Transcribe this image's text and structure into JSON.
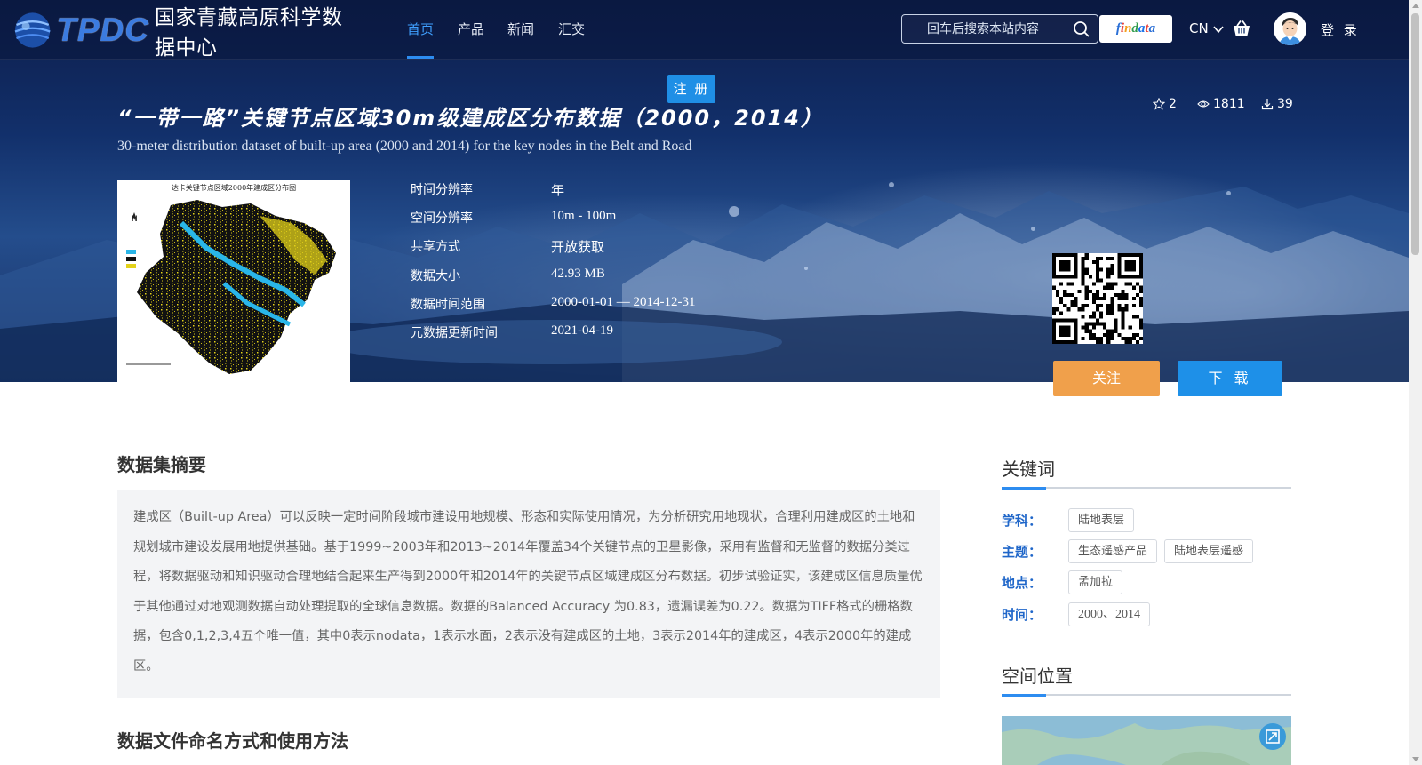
{
  "header": {
    "logo_text": "TPDC",
    "logo_cn": "国家青藏高原科学数据中心",
    "nav": [
      "首页",
      "产品",
      "新闻",
      "汇交"
    ],
    "search_placeholder": "回车后搜索本站内容",
    "findata_label": "findata",
    "findata_letters": [
      "f",
      "i",
      "n",
      "d",
      "a",
      "t",
      "a"
    ],
    "findata_colors": [
      "#2a6fd6",
      "#e8453c",
      "#f2a01e",
      "#2f9b4c",
      "#1a73e8",
      "#e8453c",
      "#2a6fd6"
    ],
    "language": "CN",
    "login": "登 录"
  },
  "register_label": "注 册",
  "dataset": {
    "title": "“一带一路”关键节点区域30m级建成区分布数据（2000，2014）",
    "subtitle": "30-meter distribution dataset of built-up area (2000 and 2014) for the key nodes in the Belt and Road",
    "stars": "2",
    "views": "1811",
    "downloads": "39",
    "thumbnail_caption": "达卡关键节点区域2000年建成区分布图",
    "meta": [
      {
        "key": "时间分辨率",
        "value": "年"
      },
      {
        "key": "空间分辨率",
        "value": "10m - 100m"
      },
      {
        "key": "共享方式",
        "value": "开放获取"
      },
      {
        "key": "数据大小",
        "value": "42.93 MB"
      },
      {
        "key": "数据时间范围",
        "value": "2000-01-01 — 2014-12-31"
      },
      {
        "key": "元数据更新时间",
        "value": "2021-04-19"
      }
    ],
    "follow_label": "关注",
    "download_label": "下 载"
  },
  "abstract": {
    "heading": "数据集摘要",
    "text": "建成区（Built-up Area）可以反映一定时间阶段城市建设用地规模、形态和实际使用情况，为分析研究用地现状，合理利用建成区的土地和规划城市建设发展用地提供基础。基于1999~2003年和2013~2014年覆盖34个关键节点的卫星影像，采用有监督和无监督的数据分类过程，将数据驱动和知识驱动合理地结合起来生产得到2000年和2014年的关键节点区域建成区分布数据。初步试验证实，该建成区信息质量优于其他通过对地观测数据自动处理提取的全球信息数据。数据的Balanced Accuracy 为0.83，遗漏误差为0.22。数据为TIFF格式的栅格数据，包含0,1,2,3,4五个唯一值，其中0表示nodata，1表示水面，2表示没有建成区的土地，3表示2014年的建成区，4表示2000年的建成区。"
  },
  "naming_heading": "数据文件命名方式和使用方法",
  "keywords": {
    "heading": "关键词",
    "rows": [
      {
        "label": "学科：",
        "tags": [
          "陆地表层"
        ]
      },
      {
        "label": "主题：",
        "tags": [
          "生态遥感产品",
          "陆地表层遥感"
        ]
      },
      {
        "label": "地点：",
        "tags": [
          "孟加拉"
        ]
      },
      {
        "label": "时间：",
        "tags": [
          "2000、2014"
        ]
      }
    ]
  },
  "location_heading": "空间位置"
}
